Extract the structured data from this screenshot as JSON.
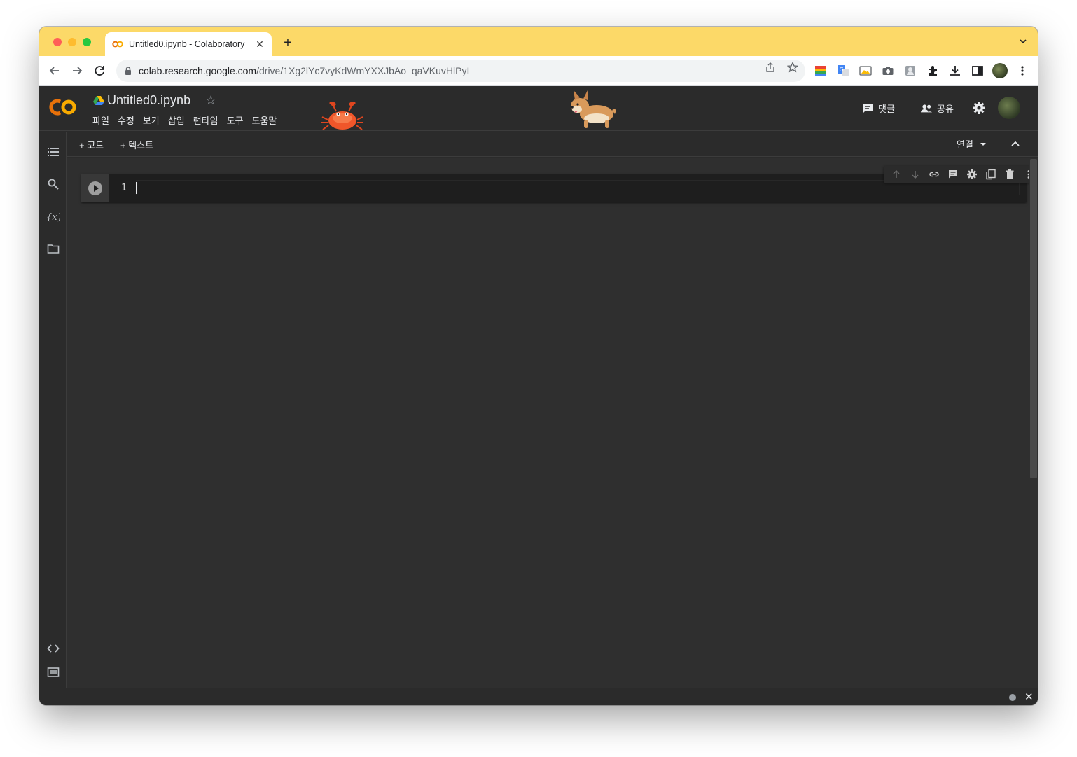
{
  "browser": {
    "tab_title": "Untitled0.ipynb - Colaboratory",
    "tab_close": "✕",
    "new_tab": "+",
    "url_host": "colab.research.google.com",
    "url_path": "/drive/1Xg2lYc7vyKdWmYXXJbAo_qaVKuvHlPyI"
  },
  "colab": {
    "notebook_title": "Untitled0.ipynb",
    "star": "☆",
    "menu": [
      "파일",
      "수정",
      "보기",
      "삽입",
      "런타임",
      "도구",
      "도움말"
    ],
    "comment_label": "댓글",
    "share_label": "공유"
  },
  "notebook_toolbar": {
    "add_code": "+ 코드",
    "add_text": "+ 텍스트",
    "connect": "연결"
  },
  "cell": {
    "line_number": "1"
  },
  "statusbar": {
    "close": "✕"
  },
  "colors": {
    "tabstrip": "#fcd968",
    "colab_bg": "#2b2b2b",
    "cell_bg": "#1e1e1e",
    "logo_orange": "#f9ab00",
    "logo_dark_orange": "#e8710a"
  }
}
